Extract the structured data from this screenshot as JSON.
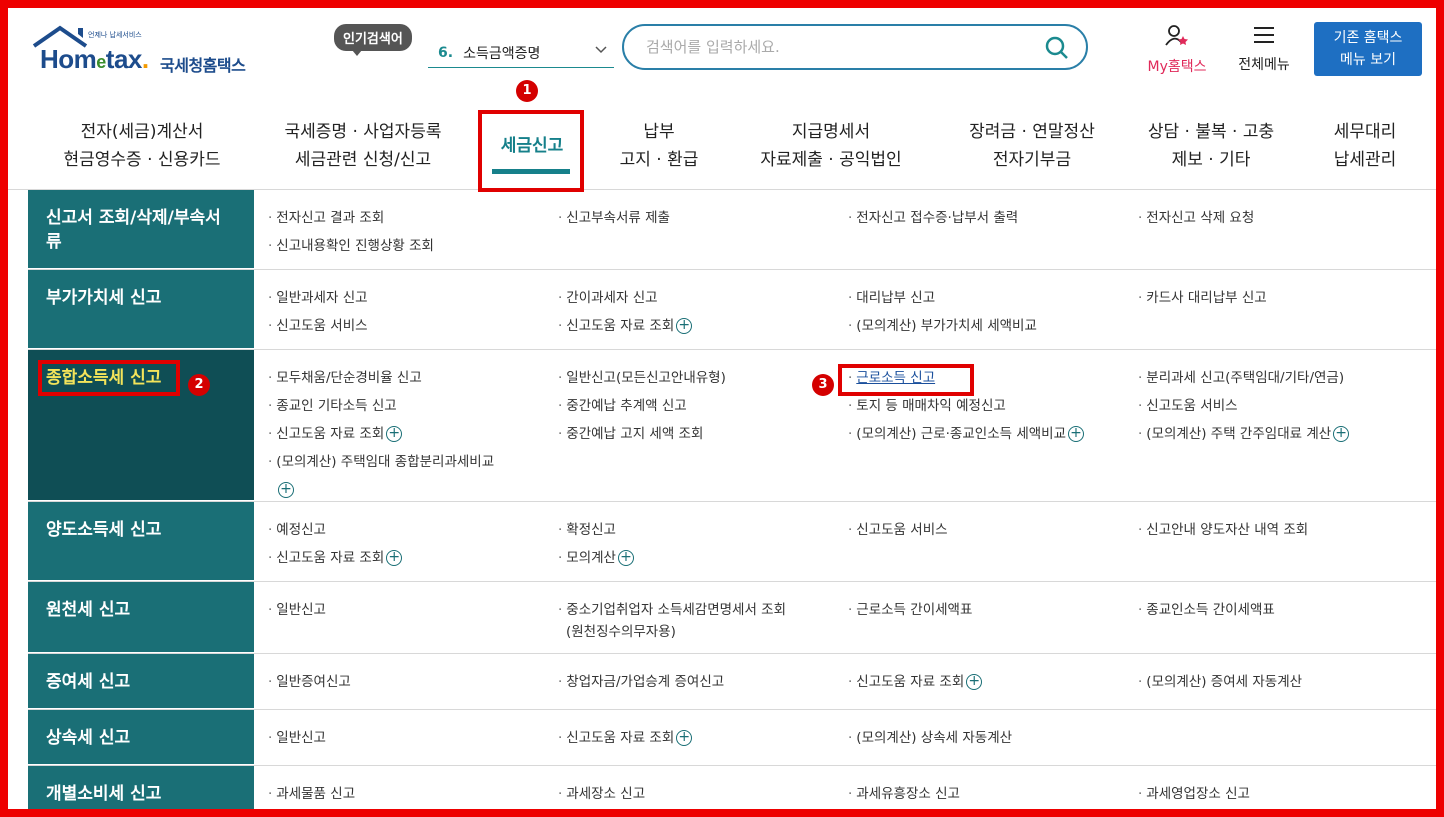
{
  "header": {
    "logo_tag": "언제나 납세서비스",
    "logo_brand_a": "Hom",
    "logo_brand_e": "e",
    "logo_brand_b": "tax",
    "logo_org": "국세청홈택스",
    "popular_badge": "인기검색어",
    "popular_num": "6.",
    "popular_text": "소득금액증명",
    "search_placeholder": "검색어를 입력하세요.",
    "myhome_label": "My홈택스",
    "allmenu_label": "전체메뉴",
    "old_btn_line1": "기존 홈택스",
    "old_btn_line2": "메뉴 보기"
  },
  "nav": [
    {
      "l1": "전자(세금)계산서",
      "l2": "현금영수증 · 신용카드"
    },
    {
      "l1": "국세증명 · 사업자등록",
      "l2": "세금관련 신청/신고"
    },
    {
      "l1": "세금신고",
      "l2": ""
    },
    {
      "l1": "납부",
      "l2": "고지 · 환급"
    },
    {
      "l1": "지급명세서",
      "l2": "자료제출 · 공익법인"
    },
    {
      "l1": "장려금 · 연말정산",
      "l2": "전자기부금"
    },
    {
      "l1": "상담 · 불복 · 고충",
      "l2": "제보 · 기타"
    },
    {
      "l1": "세무대리",
      "l2": "납세관리"
    }
  ],
  "markers": {
    "m1": "1",
    "m2": "2",
    "m3": "3"
  },
  "rows": [
    {
      "cat": "신고서 조회/삭제/부속서류",
      "l1": [
        "전자신고 결과 조회",
        "신고부속서류 제출",
        "전자신고 접수증·납부서 출력",
        "전자신고 삭제 요청"
      ],
      "l2": [
        "신고내용확인 진행상황 조회"
      ]
    },
    {
      "cat": "부가가치세 신고",
      "l1": [
        "일반과세자 신고",
        "간이과세자 신고",
        "대리납부 신고",
        "카드사 대리납부 신고"
      ],
      "l2": [
        "신고도움 서비스",
        "신고도움 자료 조회",
        "(모의계산) 부가가치세 세액비교"
      ]
    },
    {
      "cat": "종합소득세 신고",
      "l1": [
        "모두채움/단순경비율 신고",
        "일반신고(모든신고안내유형)",
        "근로소득 신고",
        "분리과세 신고(주택임대/기타/연금)"
      ],
      "l2": [
        "종교인 기타소득 신고",
        "중간예납 추계액 신고",
        "토지 등 매매차익 예정신고",
        "신고도움 서비스"
      ],
      "l3": [
        "신고도움 자료 조회",
        "중간예납 고지 세액 조회",
        "(모의계산) 근로·종교인소득 세액비교",
        "(모의계산) 주택 간주임대료 계산"
      ],
      "l4": [
        "(모의계산) 주택임대 종합분리과세비교"
      ]
    },
    {
      "cat": "양도소득세 신고",
      "l1": [
        "예정신고",
        "확정신고",
        "신고도움 서비스",
        "신고안내 양도자산 내역 조회"
      ],
      "l2": [
        "신고도움 자료 조회",
        "모의계산"
      ]
    },
    {
      "cat": "원천세 신고",
      "l1": [
        "일반신고",
        "중소기업취업자 소득세감면명세서 조회",
        "근로소득 간이세액표",
        "종교인소득 간이세액표"
      ],
      "l2": [
        "",
        "(원천징수의무자용)"
      ]
    },
    {
      "cat": "증여세 신고",
      "l1": [
        "일반증여신고",
        "창업자금/가업승계 증여신고",
        "신고도움 자료 조회",
        "(모의계산) 증여세 자동계산"
      ]
    },
    {
      "cat": "상속세 신고",
      "l1": [
        "일반신고",
        "신고도움 자료 조회",
        "(모의계산) 상속세 자동계산"
      ]
    },
    {
      "cat": "개별소비세 신고",
      "l1": [
        "과세물품 신고",
        "과세장소 신고",
        "과세유흥장소 신고",
        "과세영업장소 신고"
      ]
    }
  ],
  "colors": {
    "frame": "#ee0000",
    "teal": "#1a6f76",
    "active": "#16808a",
    "highlight_box": "#e00000"
  }
}
